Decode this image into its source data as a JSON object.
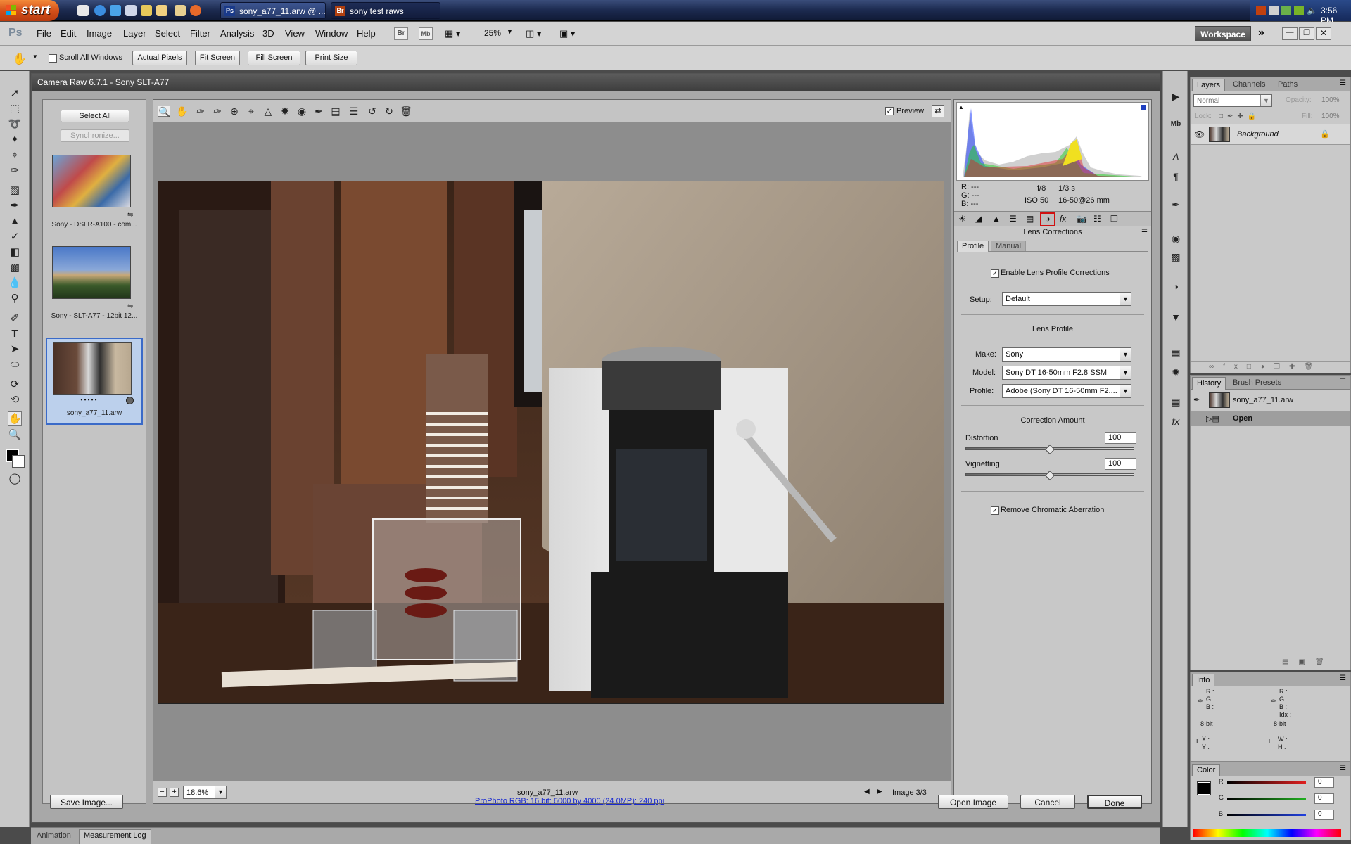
{
  "taskbar": {
    "start_label": "start",
    "tasks": [
      {
        "icon_text": "Ps",
        "label": "sony_a77_11.arw @ ..."
      },
      {
        "icon_text": "Br",
        "label": "sony test raws"
      }
    ],
    "clock": "3:56 PM"
  },
  "ps": {
    "logo": "Ps",
    "menus": [
      "File",
      "Edit",
      "Image",
      "Layer",
      "Select",
      "Filter",
      "Analysis",
      "3D",
      "View",
      "Window",
      "Help"
    ],
    "mb_icon": "Mb",
    "zoom": "25%",
    "workspace_label": "Workspace",
    "options": {
      "scroll_all_windows": "Scroll All Windows",
      "actual_pixels": "Actual Pixels",
      "fit_screen": "Fit Screen",
      "fill_screen": "Fill Screen",
      "print_size": "Print Size"
    }
  },
  "dialog": {
    "title": "Camera Raw 6.7.1  -  Sony SLT-A77",
    "select_all": "Select All",
    "synchronize": "Synchronize...",
    "thumbnails": [
      {
        "caption": "Sony - DSLR-A100 - com..."
      },
      {
        "caption": "Sony - SLT-A77 - 12bit 12..."
      },
      {
        "caption": "sony_a77_11.arw",
        "dots": "• • • • •"
      }
    ],
    "preview_label": "Preview",
    "zoom_value": "18.6%",
    "filename": "sony_a77_11.arw",
    "image_count": "Image 3/3",
    "readout": {
      "r": "R:  ---",
      "g": "G:  ---",
      "b": "B:  ---",
      "aperture": "f/8",
      "shutter": "1/3 s",
      "iso": "ISO 50",
      "lens": "16-50@26 mm"
    },
    "section_title": "Lens Corrections",
    "tabs": [
      "Profile",
      "Manual"
    ],
    "enable_profile": "Enable Lens Profile Corrections",
    "setup_label": "Setup:",
    "setup_value": "Default",
    "lens_profile_title": "Lens Profile",
    "make_label": "Make:",
    "make_value": "Sony",
    "model_label": "Model:",
    "model_value": "Sony DT 16-50mm F2.8 SSM",
    "profile_label": "Profile:",
    "profile_value": "Adobe (Sony DT 16-50mm F2....",
    "correction_title": "Correction Amount",
    "distortion_label": "Distortion",
    "distortion_value": "100",
    "vignetting_label": "Vignetting",
    "vignetting_value": "100",
    "remove_ca": "Remove Chromatic Aberration",
    "save_image": "Save Image...",
    "workflow_link": "ProPhoto RGB; 16 bit; 6000 by 4000 (24.0MP); 240 ppi",
    "open_image": "Open Image",
    "cancel": "Cancel",
    "done": "Done"
  },
  "layers_panel": {
    "tabs": [
      "Layers",
      "Channels",
      "Paths"
    ],
    "blend_mode": "Normal",
    "opacity_label": "Opacity:",
    "opacity": "100%",
    "lock_label": "Lock:",
    "fill_label": "Fill:",
    "fill": "100%",
    "layer_name": "Background"
  },
  "history_panel": {
    "tabs": [
      "History",
      "Brush Presets"
    ],
    "snapshot": "sony_a77_11.arw",
    "state": "Open"
  },
  "info_panel": {
    "title": "Info",
    "left": [
      "R :",
      "G :",
      "B :"
    ],
    "right": [
      "R :",
      "G :",
      "B :",
      "Idx :"
    ],
    "bits_left": "8-bit",
    "bits_right": "8-bit",
    "xy": [
      "X :",
      "Y :"
    ],
    "wh": [
      "W :",
      "H :"
    ]
  },
  "color_panel": {
    "title": "Color",
    "channels": [
      {
        "label": "R",
        "value": "0",
        "color": "#e02020"
      },
      {
        "label": "G",
        "value": "0",
        "color": "#20b020"
      },
      {
        "label": "B",
        "value": "0",
        "color": "#2040e0"
      }
    ]
  },
  "bottom_tabs": [
    "Animation",
    "Measurement Log"
  ]
}
